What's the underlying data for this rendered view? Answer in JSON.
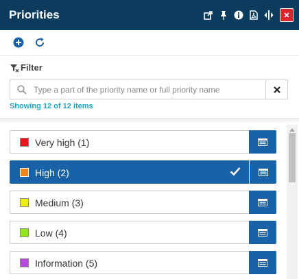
{
  "header": {
    "title": "Priorities",
    "icons": [
      "popout-icon",
      "pin-icon",
      "info-icon",
      "pdf-icon",
      "resize-icon",
      "close-icon"
    ],
    "bg_color": "#0b3c5d",
    "close_color": "#d9262a"
  },
  "toolbar": {
    "icons": [
      "add-icon",
      "refresh-icon"
    ]
  },
  "filter": {
    "label": "Filter",
    "placeholder": "Type a part of the priority name or full priority name",
    "value": "",
    "showing_text": "Showing 12 of 12 items"
  },
  "items": [
    {
      "label": "Very high (1)",
      "color": "#e8161b",
      "selected": false
    },
    {
      "label": "High (2)",
      "color": "#f0861a",
      "selected": true
    },
    {
      "label": "Medium (3)",
      "color": "#eded12",
      "selected": false
    },
    {
      "label": "Low (4)",
      "color": "#93e61a",
      "selected": false
    },
    {
      "label": "Information (5)",
      "color": "#b84ae0",
      "selected": false
    }
  ],
  "accent_color": "#1a62a8"
}
